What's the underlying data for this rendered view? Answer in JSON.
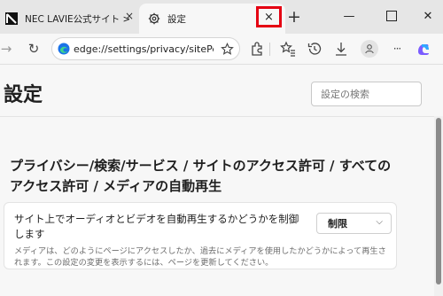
{
  "tabs": [
    {
      "title": "NEC LAVIE公式サイト > サ",
      "close": "×"
    },
    {
      "title": "設定",
      "close": "×"
    }
  ],
  "new_tab": "+",
  "window": {
    "minimize": "—",
    "close": "✕"
  },
  "toolbar": {
    "address": "edge://settings/privacy/sitePermissions/allPermissions/mediaAutoplay",
    "back": "→",
    "refresh": "↻"
  },
  "settings": {
    "title": "設定",
    "search_placeholder": "設定の検索",
    "breadcrumb": "プライバシー/検索/サービス / サイトのアクセス許可 / すべてのアクセス許可 / メディアの自動再生",
    "autoplay": {
      "label": "サイト上でオーディオとビデオを自動再生するかどうかを制御します",
      "description": "メディアは、どのようにページにアクセスしたか、過去にメディアを使用したかどうかによって再生されます。この設定の変更を表示するには、ページを更新してください。",
      "selected": "制限",
      "chevron": "⌵"
    }
  },
  "colors": {
    "highlight": "#e50012",
    "edge_blue": "#1a73e8",
    "copilot_purple": "#7b5cff"
  }
}
